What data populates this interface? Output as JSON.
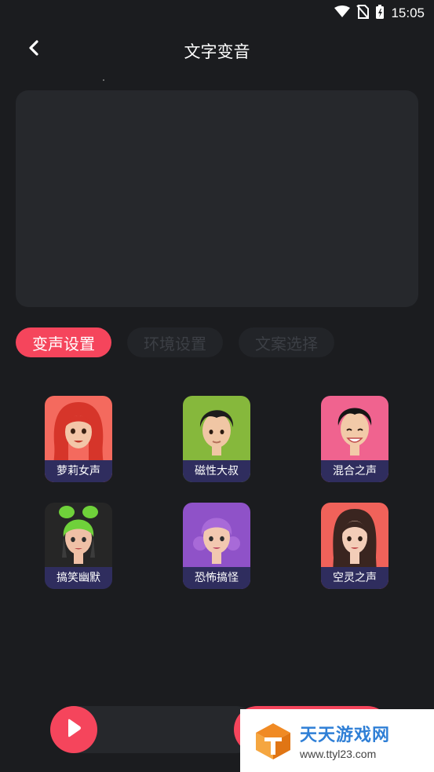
{
  "status_bar": {
    "time": "15:05",
    "icons": [
      "wifi-icon",
      "no-sim-icon",
      "battery-charging-icon"
    ]
  },
  "header": {
    "title": "文字变音",
    "back_icon": "chevron-left-icon"
  },
  "tabs": [
    {
      "label": "变声设置",
      "active": true
    },
    {
      "label": "环境设置",
      "active": false
    },
    {
      "label": "文案选择",
      "active": false
    }
  ],
  "voices": [
    {
      "label": "萝莉女声",
      "bg": "#f46a5e"
    },
    {
      "label": "磁性大叔",
      "bg": "#86b83c"
    },
    {
      "label": "混合之声",
      "bg": "#f0638f"
    },
    {
      "label": "搞笑幽默",
      "bg": "#262626"
    },
    {
      "label": "恐怖搞怪",
      "bg": "#8f52c8"
    },
    {
      "label": "空灵之声",
      "bg": "#f0625a"
    }
  ],
  "player": {
    "play_icon": "play-icon"
  },
  "watermark": {
    "name": "天天游戏网",
    "url": "www.ttyl23.com"
  },
  "colors": {
    "accent": "#f5455c",
    "background": "#1b1c1f",
    "panel": "#26282c",
    "label_bg": "#2f2d5e"
  }
}
